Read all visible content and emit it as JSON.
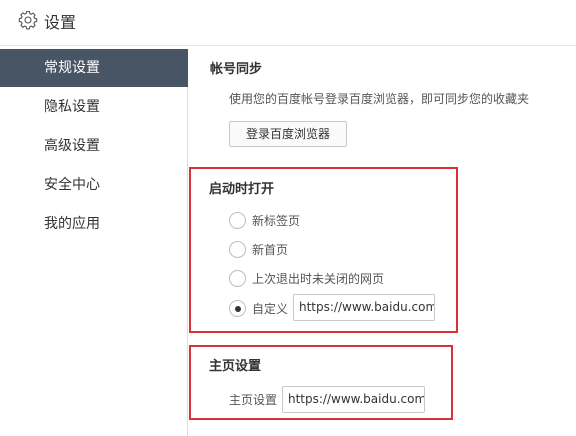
{
  "header": {
    "title": "设置",
    "icon": "gear-icon"
  },
  "sidebar": {
    "items": [
      {
        "label": "常规设置",
        "active": true
      },
      {
        "label": "隐私设置",
        "active": false
      },
      {
        "label": "高级设置",
        "active": false
      },
      {
        "label": "安全中心",
        "active": false
      },
      {
        "label": "我的应用",
        "active": false
      }
    ]
  },
  "account_sync": {
    "title": "帐号同步",
    "description": "使用您的百度帐号登录百度浏览器，即可同步您的收藏夹",
    "button_label": "登录百度浏览器"
  },
  "startup": {
    "title": "启动时打开",
    "options": [
      {
        "label": "新标签页",
        "checked": false
      },
      {
        "label": "新首页",
        "checked": false
      },
      {
        "label": "上次退出时未关闭的网页",
        "checked": false
      },
      {
        "label": "自定义",
        "checked": true
      }
    ],
    "custom_url": "https://www.baidu.com"
  },
  "homepage": {
    "title": "主页设置",
    "label": "主页设置",
    "url": "https://www.baidu.com"
  },
  "colors": {
    "sidebar_active": "#485565",
    "highlight_border": "#d9313a"
  }
}
